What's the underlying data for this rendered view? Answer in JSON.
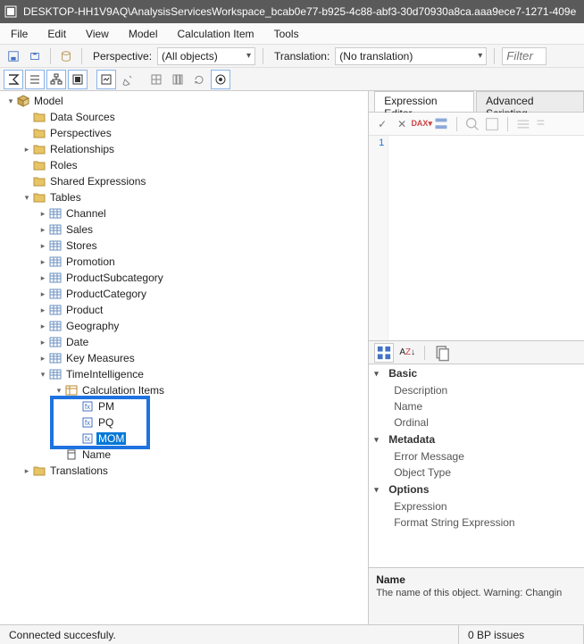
{
  "title": "DESKTOP-HH1V9AQ\\AnalysisServicesWorkspace_bcab0e77-b925-4c88-abf3-30d70930a8ca.aaa9ece7-1271-409e",
  "menubar": {
    "items": [
      "File",
      "Edit",
      "View",
      "Model",
      "Calculation Item",
      "Tools"
    ]
  },
  "toolbar1": {
    "perspective_label": "Perspective:",
    "perspective_value": "(All objects)",
    "translation_label": "Translation:",
    "translation_value": "(No translation)",
    "filter_placeholder": "Filter"
  },
  "tree": {
    "root": "Model",
    "dataSources": "Data Sources",
    "perspectives": "Perspectives",
    "relationships": "Relationships",
    "roles": "Roles",
    "sharedExpr": "Shared Expressions",
    "tables": "Tables",
    "tableList": [
      "Channel",
      "Sales",
      "Stores",
      "Promotion",
      "ProductSubcategory",
      "ProductCategory",
      "Product",
      "Geography",
      "Date",
      "Key Measures",
      "TimeIntelligence"
    ],
    "calcItemsLabel": "Calculation Items",
    "calcItems": [
      "PM",
      "PQ",
      "MOM"
    ],
    "nameCol": "Name",
    "translations": "Translations"
  },
  "rightTabs": {
    "exprEditor": "Expression Editor",
    "advScript": "Advanced Scripting"
  },
  "editor": {
    "line1": "1"
  },
  "propCategories": {
    "basic": {
      "label": "Basic",
      "items": [
        "Description",
        "Name",
        "Ordinal"
      ]
    },
    "metadata": {
      "label": "Metadata",
      "items": [
        "Error Message",
        "Object Type"
      ]
    },
    "options": {
      "label": "Options",
      "items": [
        "Expression",
        "Format String Expression"
      ]
    }
  },
  "propDesc": {
    "name": "Name",
    "text": "The name of this object. Warning: Changin"
  },
  "status": {
    "left": "Connected succesfuly.",
    "right": "0 BP issues"
  }
}
